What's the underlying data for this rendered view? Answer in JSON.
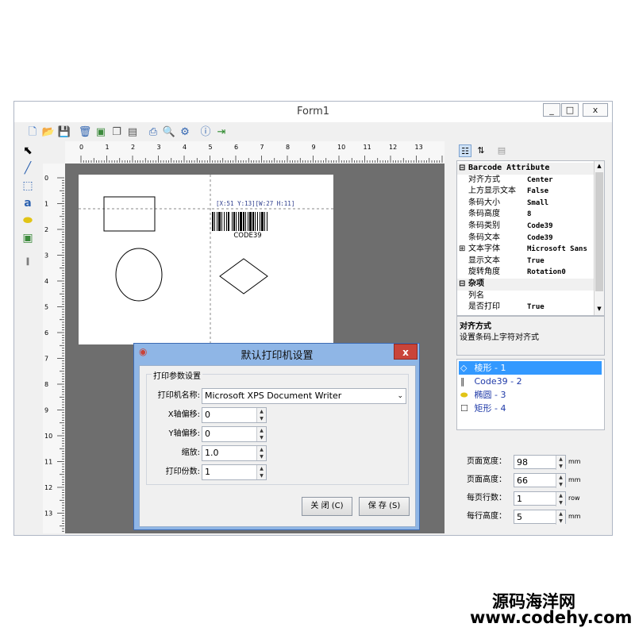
{
  "window": {
    "title": "Form1",
    "minimize": "_",
    "maximize": "□",
    "close": "x"
  },
  "toolbar": {
    "icons": [
      "new-icon",
      "open-icon",
      "save-icon",
      "delete-icon",
      "image-icon",
      "copy-icon",
      "layout-icon",
      "print-preview-icon",
      "zoom-icon",
      "settings-icon",
      "info-icon",
      "exit-icon"
    ]
  },
  "left_tools": [
    "select-arrow-icon",
    "line-icon",
    "rectangle-icon",
    "text-icon",
    "ellipse-icon",
    "image-icon",
    "barcode-icon"
  ],
  "hruler": {
    "labels": [
      "0",
      "1",
      "2",
      "3",
      "4",
      "5",
      "6",
      "7",
      "8",
      "9",
      "10",
      "11",
      "12",
      "13"
    ]
  },
  "vruler": {
    "labels": [
      "0",
      "1",
      "2",
      "3",
      "4",
      "5",
      "6",
      "7",
      "8",
      "9",
      "10",
      "11",
      "12",
      "13"
    ]
  },
  "canvas": {
    "barcode_info": "[X:51 Y:13][W:27 H:11]",
    "barcode_text": "CODE39"
  },
  "propgrid": {
    "rows": [
      {
        "type": "cat",
        "name": "Barcode Attribute"
      },
      {
        "name": "对齐方式",
        "value": "Center"
      },
      {
        "name": "上方显示文本",
        "value": "False"
      },
      {
        "name": "条码大小",
        "value": "Small"
      },
      {
        "name": "条码高度",
        "value": "8"
      },
      {
        "name": "条码类别",
        "value": "Code39"
      },
      {
        "name": "条码文本",
        "value": "Code39"
      },
      {
        "name": "文本字体",
        "value": "Microsoft Sans",
        "expand": "⊞"
      },
      {
        "name": "显示文本",
        "value": "True"
      },
      {
        "name": "旋转角度",
        "value": "Rotation0"
      },
      {
        "type": "cat",
        "name": "杂项"
      },
      {
        "name": "列名",
        "value": ""
      },
      {
        "name": "是否打印",
        "value": "True"
      }
    ],
    "cat_toggle": "⊟"
  },
  "description": {
    "title": "对齐方式",
    "text": "设置条码上字符对齐式"
  },
  "object_list": [
    {
      "label": "棱形 - 1",
      "selected": true
    },
    {
      "label": "Code39 - 2",
      "selected": false
    },
    {
      "label": "椭圆 - 3",
      "selected": false
    },
    {
      "label": "矩形 - 4",
      "selected": false
    }
  ],
  "page_settings": {
    "width_label": "页面宽度：",
    "width_value": "98",
    "width_unit": "mm",
    "height_label": "页面高度：",
    "height_value": "66",
    "height_unit": "mm",
    "rows_label": "每页行数：",
    "rows_value": "1",
    "rows_unit": "row",
    "rowh_label": "每行高度：",
    "rowh_value": "5",
    "rowh_unit": "mm"
  },
  "dialog": {
    "title": "默认打印机设置",
    "group": "打印参数设置",
    "printer_label": "打印机名称:",
    "printer_value": "Microsoft XPS Document Writer",
    "x_label": "X轴偏移:",
    "x_value": "0",
    "y_label": "Y轴偏移:",
    "y_value": "0",
    "scale_label": "缩放:",
    "scale_value": "1.0",
    "copies_label": "打印份数:",
    "copies_value": "1",
    "close_btn": "关 闭 (C)",
    "save_btn": "保 存 (S)",
    "close_x": "x"
  },
  "watermark": {
    "line1": "源码海洋网",
    "line2": "www.codehy.com"
  }
}
